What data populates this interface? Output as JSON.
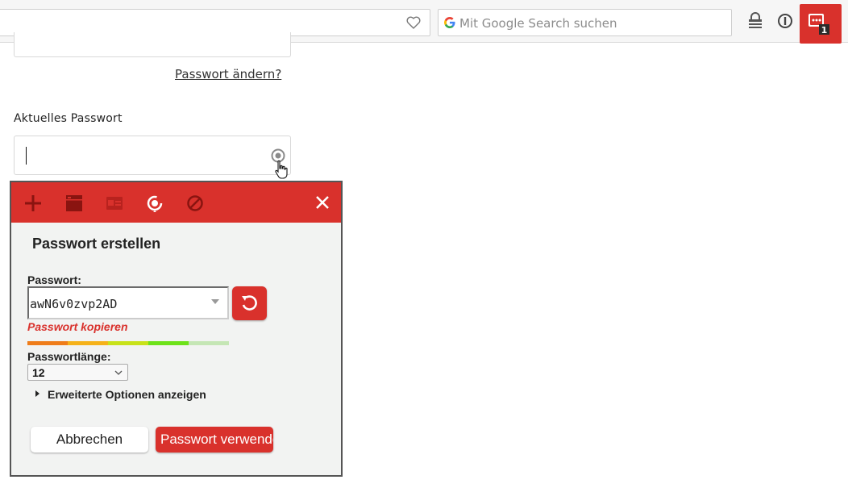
{
  "browser": {
    "search_placeholder": "Mit Google Search suchen",
    "extension_badge": "1"
  },
  "page": {
    "change_password_link": "Passwort ändern?",
    "current_password_label": "Aktuelles Passwort"
  },
  "popup": {
    "title": "Passwort erstellen",
    "password_label": "Passwort:",
    "password_value": "awN6v0zvp2AD",
    "copy_link": "Passwort kopieren",
    "length_label": "Passwortlänge:",
    "length_value": "12",
    "advanced_options": "Erweiterte Optionen anzeigen",
    "cancel_button": "Abbrechen",
    "use_button": "Passwort verwenden",
    "header_icons": [
      "plus-icon",
      "window-icon",
      "card-icon",
      "lock-refresh-icon",
      "block-icon",
      "close-icon"
    ]
  },
  "colors": {
    "accent": "#d9312c",
    "strength": [
      "#ef7d1a",
      "#f5b21a",
      "#c8e21a",
      "#6ee21a",
      "#c5e6b5"
    ]
  }
}
